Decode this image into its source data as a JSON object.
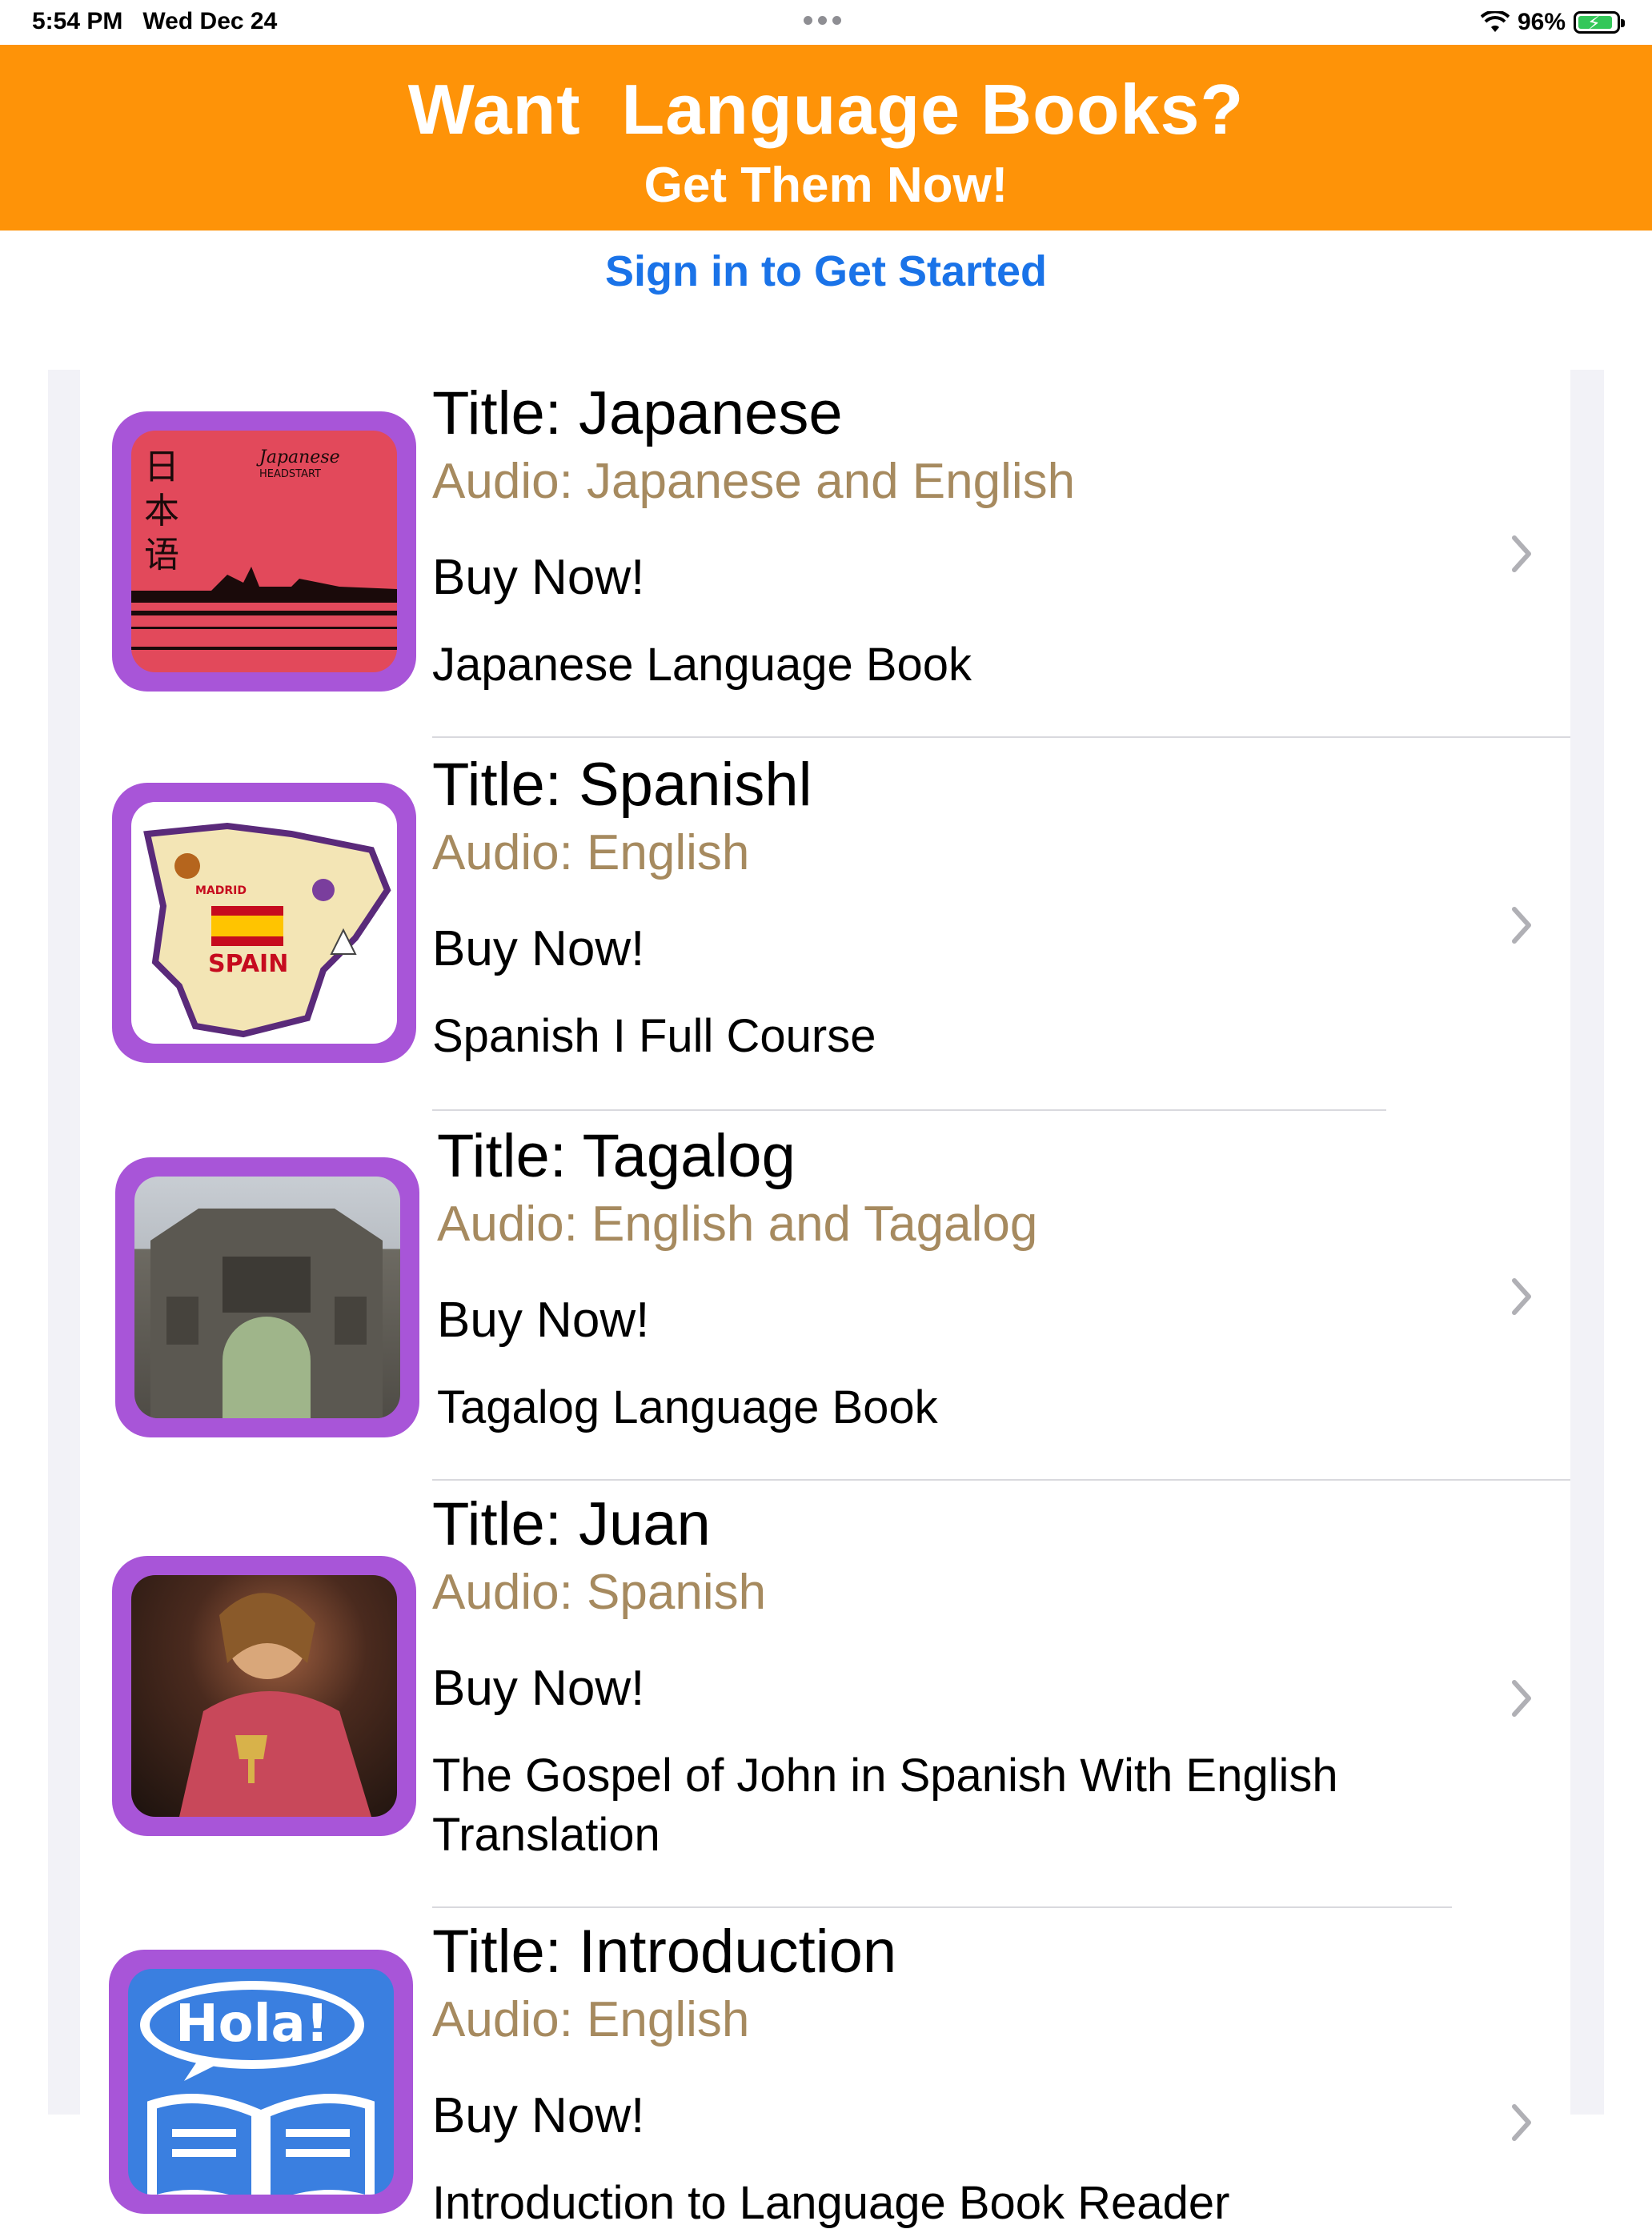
{
  "status_bar": {
    "time": "5:54 PM",
    "date": "Wed Dec 24",
    "battery": "96%",
    "battery_level": 0.96
  },
  "banner": {
    "title": "Want  Language Books?",
    "subtitle": "Get Them Now!",
    "color": "#fe9308"
  },
  "signin_label": "Sign in to Get Started",
  "books": [
    {
      "title": "Title: Japanese",
      "audio": "Audio: Japanese and English",
      "buy": "Buy Now!",
      "description": "Japanese Language Book",
      "cover_text": [
        "日本语",
        "Japanese",
        "HEADSTART"
      ]
    },
    {
      "title": "Title: Spanishl",
      "audio": "Audio: English",
      "buy": "Buy Now!",
      "description": "Spanish I Full Course",
      "cover_text": [
        "SPAIN",
        "MADRID"
      ]
    },
    {
      "title": "Title: Tagalog",
      "audio": "Audio: English and Tagalog",
      "buy": "Buy Now!",
      "description": "Tagalog Language Book"
    },
    {
      "title": "Title: Juan",
      "audio": "Audio: Spanish",
      "buy": "Buy Now!",
      "description": "The Gospel of John in Spanish With English Translation"
    },
    {
      "title": "Title: Introduction",
      "audio": "Audio: English",
      "buy": "Buy Now!",
      "description": "Introduction to Language Book Reader",
      "cover_text": [
        "Hola!"
      ]
    }
  ],
  "colors": {
    "accent_link": "#1a73e8",
    "audio_text": "#a68a5f",
    "thumb_frame": "#a855d8"
  }
}
